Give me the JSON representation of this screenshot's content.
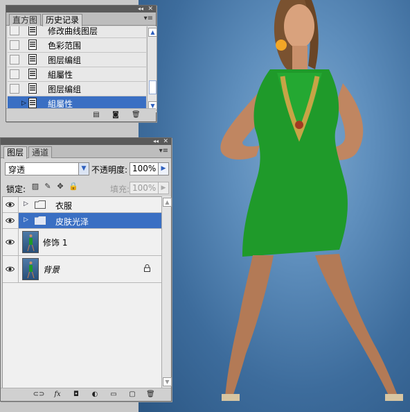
{
  "history_panel": {
    "tabs": [
      "直方图",
      "历史记录"
    ],
    "active_tab": 1,
    "items": [
      {
        "label": "修改曲线图层",
        "selected": false
      },
      {
        "label": "色彩范围",
        "selected": false
      },
      {
        "label": "图层编组",
        "selected": false
      },
      {
        "label": "組屬性",
        "selected": false
      },
      {
        "label": "图层编组",
        "selected": false
      },
      {
        "label": "組屬性",
        "selected": true
      }
    ]
  },
  "layers_panel": {
    "tabs": [
      "图层",
      "通道"
    ],
    "active_tab": 0,
    "blend_mode": "穿透",
    "opacity_label": "不透明度:",
    "opacity_value": "100%",
    "lock_label": "锁定:",
    "fill_label": "填充:",
    "fill_value": "100%",
    "layers": [
      {
        "type": "group",
        "name": "衣服",
        "selected": false,
        "visible": true
      },
      {
        "type": "group",
        "name": "皮肤光泽",
        "selected": true,
        "visible": true
      },
      {
        "type": "layer",
        "name": "修饰 1",
        "selected": false,
        "visible": true,
        "italic": false,
        "locked": false
      },
      {
        "type": "layer",
        "name": "背景",
        "selected": false,
        "visible": true,
        "italic": true,
        "locked": true
      }
    ],
    "bottom_icons": [
      "link-icon",
      "fx-icon",
      "mask-icon",
      "adjustment-icon",
      "new-group-icon",
      "new-layer-icon",
      "trash-icon"
    ]
  },
  "colors": {
    "selection": "#3a6fc3",
    "dress": "#1f9a2a",
    "backdrop": "#3d6c9c"
  }
}
